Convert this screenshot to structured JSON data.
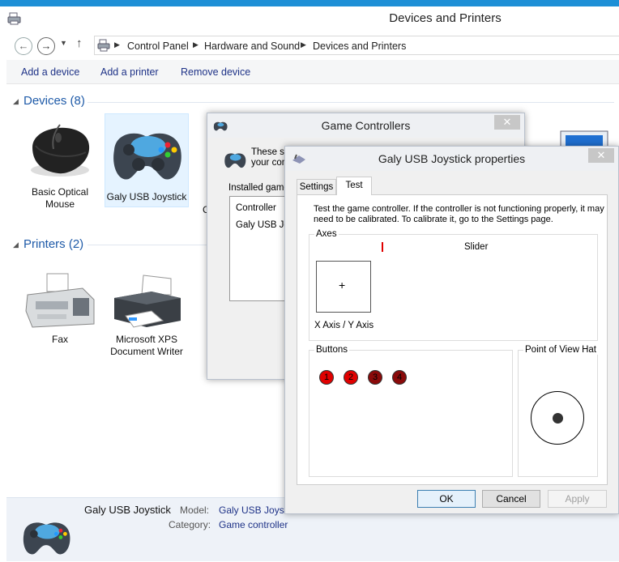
{
  "window": {
    "title": "Devices and Printers"
  },
  "address": {
    "crumbs": [
      "Control Panel",
      "Hardware and Sound",
      "Devices and Printers"
    ]
  },
  "commands": [
    "Add a device",
    "Add a printer",
    "Remove device"
  ],
  "groups": {
    "devices": {
      "label": "Devices (8)",
      "items": [
        "Basic Optical Mouse",
        "Galy USB Joystick"
      ]
    },
    "printers": {
      "label": "Printers (2)",
      "items": [
        "Fax",
        "Microsoft XPS Document Writer"
      ]
    }
  },
  "details": {
    "name": "Galy USB Joystick",
    "model_label": "Model:",
    "model_value": "Galy USB Joystick",
    "category_label": "Category:",
    "category_value": "Game controller"
  },
  "game_controllers": {
    "title": "Game Controllers",
    "desc_lines": [
      "These se",
      "your com"
    ],
    "installed_label": "Installed game",
    "col_header": "Controller",
    "row": "Galy USB Jo"
  },
  "props": {
    "title": "Galy USB Joystick properties",
    "tabs": [
      "Settings",
      "Test"
    ],
    "active_tab": "Test",
    "info_lines": [
      "Test the game controller.  If the controller is not functioning properly, it may",
      "need to be calibrated.  To calibrate it, go to the Settings page."
    ],
    "axes_label": "Axes",
    "slider_label": "Slider",
    "xy_label": "X Axis / Y Axis",
    "buttons_label": "Buttons",
    "button_numbers": [
      "1",
      "2",
      "3",
      "4"
    ],
    "pov_label": "Point of View Hat",
    "ok": "OK",
    "cancel": "Cancel",
    "apply": "Apply"
  },
  "colors": {
    "link": "#1e3287",
    "group_header": "#1e5aa8",
    "button_pressed": "#e00000",
    "button_idle": "#8a0a0a"
  }
}
